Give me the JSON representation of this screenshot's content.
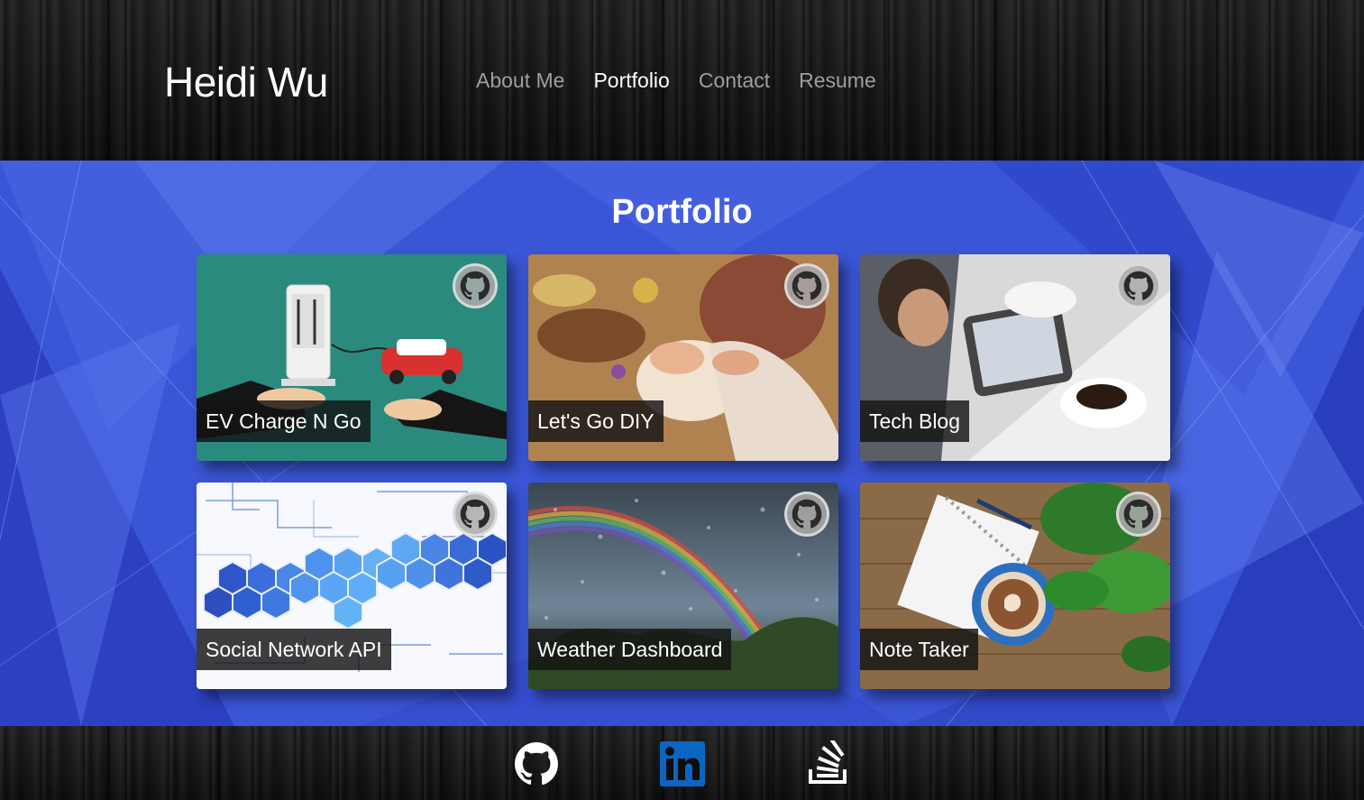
{
  "header": {
    "brand": "Heidi Wu",
    "nav": [
      {
        "label": "About Me",
        "active": false
      },
      {
        "label": "Portfolio",
        "active": true
      },
      {
        "label": "Contact",
        "active": false
      },
      {
        "label": "Resume",
        "active": false
      }
    ]
  },
  "portfolio": {
    "title": "Portfolio",
    "projects": [
      {
        "title": "EV Charge N Go",
        "icon": "github-icon"
      },
      {
        "title": "Let's Go DIY",
        "icon": "github-icon"
      },
      {
        "title": "Tech Blog",
        "icon": "github-icon"
      },
      {
        "title": "Social Network API",
        "icon": "github-icon"
      },
      {
        "title": "Weather Dashboard",
        "icon": "github-icon"
      },
      {
        "title": "Note Taker",
        "icon": "github-icon"
      }
    ]
  },
  "footer": {
    "links": [
      {
        "name": "github-icon"
      },
      {
        "name": "linkedin-icon"
      },
      {
        "name": "stackoverflow-icon"
      }
    ]
  },
  "colors": {
    "section_blue": "#3a55d6",
    "nav_inactive": "#9e9e9e",
    "nav_active": "#ffffff",
    "linkedin_blue": "#0a66c2"
  }
}
